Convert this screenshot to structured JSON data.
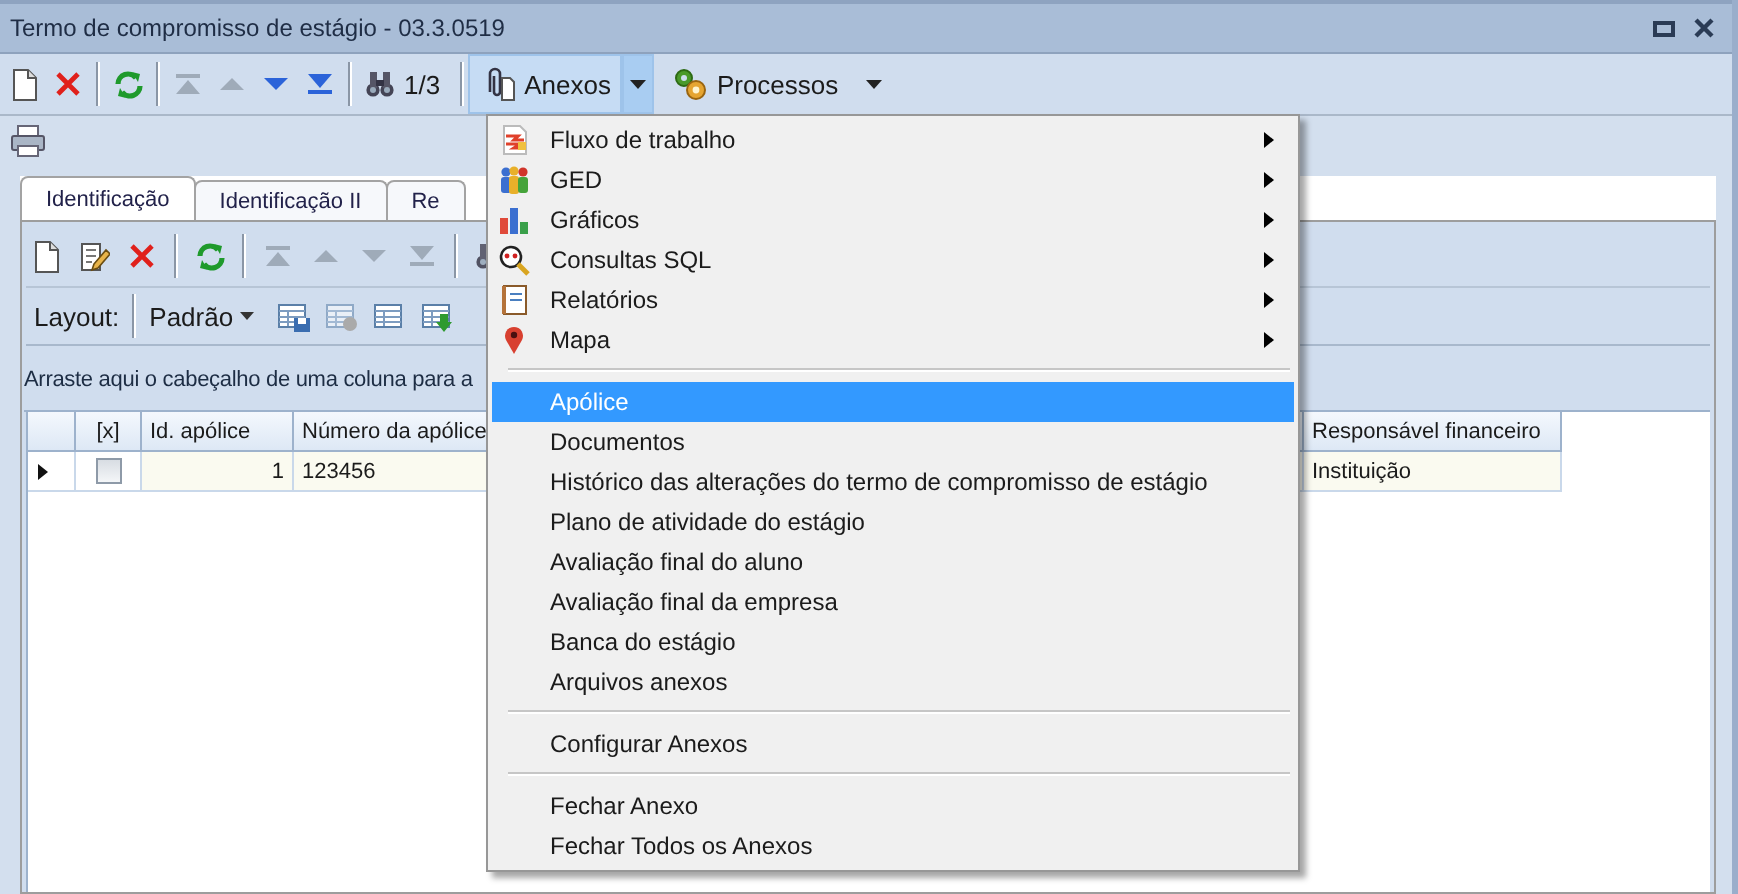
{
  "window": {
    "title": "Termo de compromisso de estágio - 03.3.0519"
  },
  "toolbar": {
    "navigation": [
      {
        "disabled": true
      },
      {
        "disabled": true
      },
      {
        "disabled": false
      },
      {
        "disabled": false
      }
    ],
    "record_counter": "1/3",
    "anexos_button": {
      "label": "Anexos",
      "pressed": true
    },
    "processos_button": {
      "label": "Processos"
    }
  },
  "tabs": [
    {
      "label": "Identificação",
      "selected": true
    },
    {
      "label": "Identificação II",
      "selected": false
    },
    {
      "label": "Re",
      "selected": false
    }
  ],
  "inner_toolbar": {
    "navigation": [
      {
        "disabled": true
      },
      {
        "disabled": true
      },
      {
        "disabled": true
      },
      {
        "disabled": true
      }
    ]
  },
  "layout_bar": {
    "label": "Layout:",
    "value": "Padrão"
  },
  "group_panel": {
    "text": "Arraste aqui o cabeçalho de uma coluna para a"
  },
  "grid": {
    "columns": [
      "[x]",
      "Id. apólice",
      "Número da apólice",
      "Responsável financeiro"
    ],
    "rows": [
      {
        "current": true,
        "checked": false,
        "cells": [
          "",
          "1",
          "123456",
          "Instituição"
        ]
      }
    ]
  },
  "menu": {
    "items": [
      {
        "kind": "submenu",
        "label": "Fluxo de trabalho",
        "selected": false
      },
      {
        "kind": "submenu",
        "label": "GED",
        "selected": false
      },
      {
        "kind": "submenu",
        "label": "Gráficos",
        "selected": false
      },
      {
        "kind": "submenu",
        "label": "Consultas SQL",
        "selected": false
      },
      {
        "kind": "submenu",
        "label": "Relatórios",
        "selected": false
      },
      {
        "kind": "submenu",
        "label": "Mapa",
        "selected": false
      },
      {
        "kind": "separator"
      },
      {
        "kind": "item",
        "label": "Apólice",
        "selected": true
      },
      {
        "kind": "item",
        "label": "Documentos",
        "selected": false
      },
      {
        "kind": "item",
        "label": "Histórico das alterações do termo de compromisso de estágio",
        "selected": false
      },
      {
        "kind": "item",
        "label": "Plano de atividade do estágio",
        "selected": false
      },
      {
        "kind": "item",
        "label": "Avaliação final do aluno",
        "selected": false
      },
      {
        "kind": "item",
        "label": "Avaliação final da empresa",
        "selected": false
      },
      {
        "kind": "item",
        "label": "Banca do estágio",
        "selected": false
      },
      {
        "kind": "item",
        "label": "Arquivos anexos",
        "selected": false
      },
      {
        "kind": "separator"
      },
      {
        "kind": "item",
        "label": "Configurar Anexos",
        "selected": false
      },
      {
        "kind": "separator"
      },
      {
        "kind": "item",
        "label": "Fechar Anexo",
        "selected": false
      },
      {
        "kind": "item",
        "label": "Fechar Todos os Anexos",
        "selected": false
      }
    ]
  }
}
